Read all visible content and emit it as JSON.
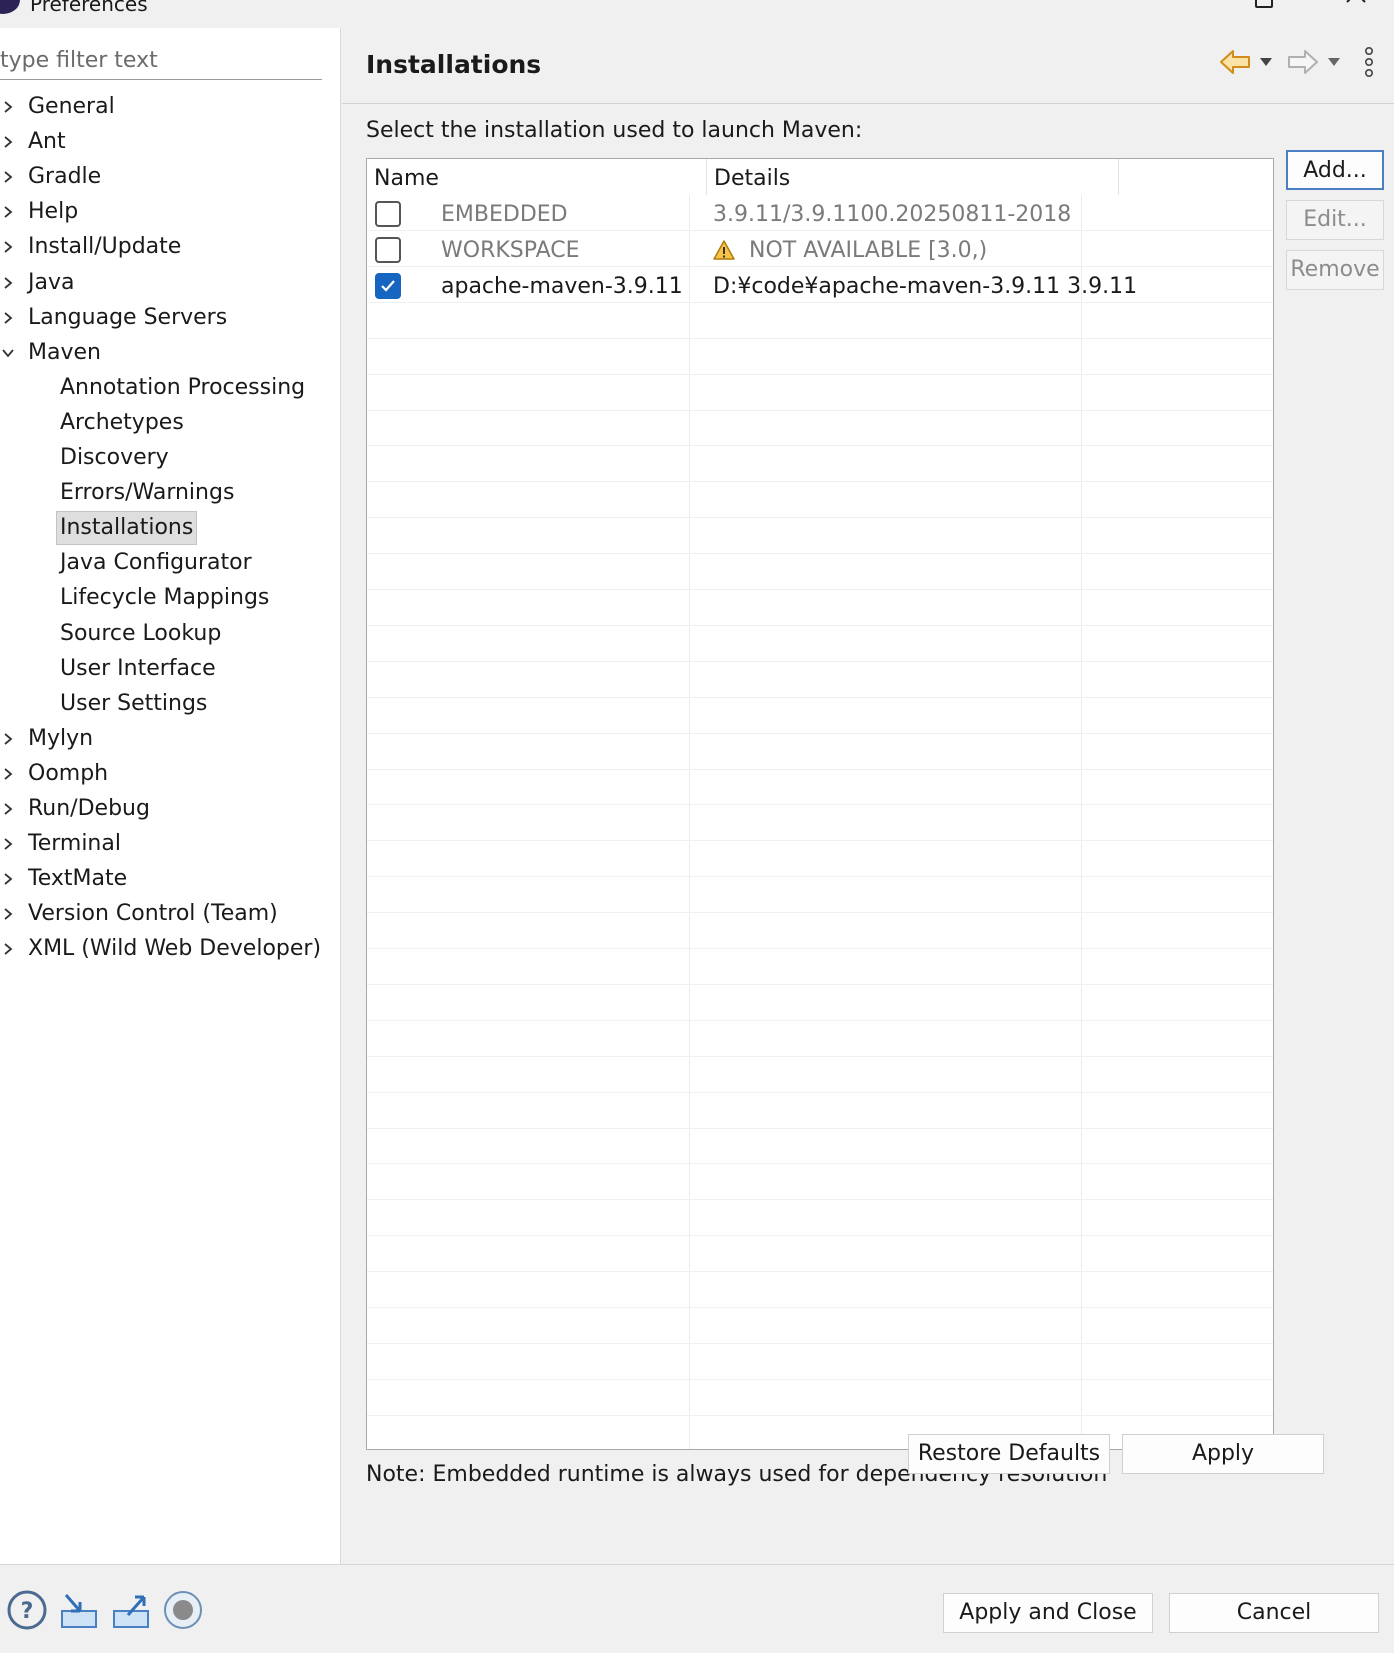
{
  "window": {
    "title": "Preferences"
  },
  "filter": {
    "placeholder": "type filter text",
    "value": ""
  },
  "tree": [
    {
      "label": "General",
      "expanded": false,
      "child": false
    },
    {
      "label": "Ant",
      "expanded": false,
      "child": false
    },
    {
      "label": "Gradle",
      "expanded": false,
      "child": false
    },
    {
      "label": "Help",
      "expanded": false,
      "child": false
    },
    {
      "label": "Install/Update",
      "expanded": false,
      "child": false
    },
    {
      "label": "Java",
      "expanded": false,
      "child": false
    },
    {
      "label": "Language Servers",
      "expanded": false,
      "child": false
    },
    {
      "label": "Maven",
      "expanded": true,
      "child": false
    },
    {
      "label": "Annotation Processing",
      "child": true
    },
    {
      "label": "Archetypes",
      "child": true
    },
    {
      "label": "Discovery",
      "child": true
    },
    {
      "label": "Errors/Warnings",
      "child": true
    },
    {
      "label": "Installations",
      "child": true,
      "selected": true
    },
    {
      "label": "Java Configurator",
      "child": true
    },
    {
      "label": "Lifecycle Mappings",
      "child": true
    },
    {
      "label": "Source Lookup",
      "child": true
    },
    {
      "label": "User Interface",
      "child": true
    },
    {
      "label": "User Settings",
      "child": true
    },
    {
      "label": "Mylyn",
      "expanded": false,
      "child": false
    },
    {
      "label": "Oomph",
      "expanded": false,
      "child": false
    },
    {
      "label": "Run/Debug",
      "expanded": false,
      "child": false
    },
    {
      "label": "Terminal",
      "expanded": false,
      "child": false
    },
    {
      "label": "TextMate",
      "expanded": false,
      "child": false
    },
    {
      "label": "Version Control (Team)",
      "expanded": false,
      "child": false
    },
    {
      "label": "XML (Wild Web Developer)",
      "expanded": false,
      "child": false
    }
  ],
  "page": {
    "title": "Installations",
    "instruction": "Select the installation used to launch Maven:",
    "table": {
      "columns": [
        "Name",
        "Details"
      ],
      "rows": [
        {
          "checked": false,
          "name": "EMBEDDED",
          "details": "3.9.11/3.9.1100.20250811-2018",
          "disabled": true,
          "warning": false
        },
        {
          "checked": false,
          "name": "WORKSPACE",
          "details": "NOT AVAILABLE [3.0,)",
          "disabled": true,
          "warning": true
        },
        {
          "checked": true,
          "name": "apache-maven-3.9.11",
          "details": "D:¥code¥apache-maven-3.9.11 3.9.11",
          "disabled": false,
          "warning": false
        }
      ]
    },
    "side_buttons": {
      "add": "Add...",
      "edit": "Edit...",
      "remove": "Remove"
    },
    "note": "Note: Embedded runtime is always used for dependency resolution",
    "restore_defaults": "Restore Defaults",
    "apply": "Apply"
  },
  "footer": {
    "apply_and_close": "Apply and Close",
    "cancel": "Cancel",
    "icons": [
      "help-icon",
      "import-icon",
      "export-icon",
      "record-icon"
    ]
  },
  "colors": {
    "accent": "#1665c0",
    "nav_back": "#e8a53a",
    "warning": "#f0b429"
  }
}
